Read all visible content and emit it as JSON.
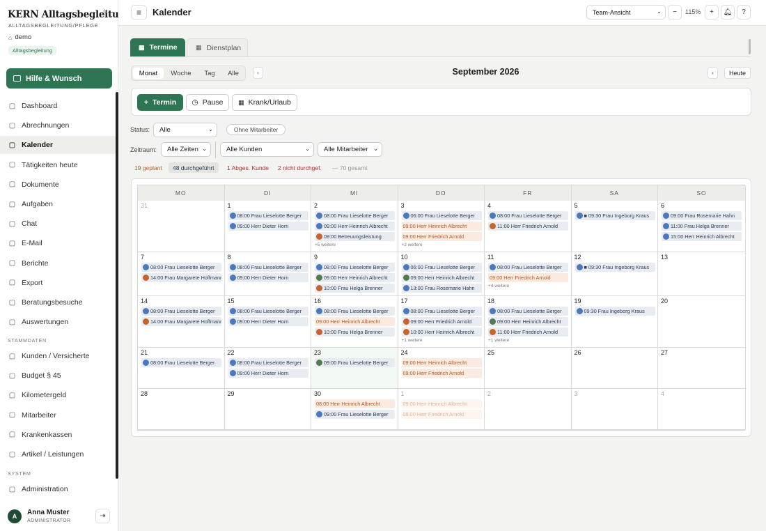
{
  "sidebar": {
    "brand": "KERN Alltagsbegleitung",
    "subtitle": "ALLTAGSBEGLEITUNG/PFLEGE",
    "tenant": "demo",
    "tenant_badge": "Alltagsbegleitung",
    "help_label": "Hilfe & Wunsch",
    "nav": [
      {
        "label": "Dashboard",
        "icon": "grid-icon"
      },
      {
        "label": "Abrechnungen",
        "icon": "file-icon"
      },
      {
        "label": "Kalender",
        "icon": "calendar-icon",
        "active": true
      },
      {
        "label": "Tätigkeiten heute",
        "icon": "clock-icon"
      },
      {
        "label": "Dokumente",
        "icon": "folder-icon"
      },
      {
        "label": "Aufgaben",
        "icon": "check-icon"
      },
      {
        "label": "Chat",
        "icon": "chat-icon"
      },
      {
        "label": "E-Mail",
        "icon": "mail-icon"
      },
      {
        "label": "Berichte",
        "icon": "chart-icon"
      },
      {
        "label": "Export",
        "icon": "download-icon"
      },
      {
        "label": "Beratungsbesuche",
        "icon": "clipboard-icon"
      },
      {
        "label": "Auswertungen",
        "icon": "pie-icon"
      }
    ],
    "section_stammdaten": "STAMMDATEN",
    "stammdaten": [
      {
        "label": "Kunden / Versicherte",
        "icon": "user-icon"
      },
      {
        "label": "Budget § 45",
        "icon": "budget-icon"
      },
      {
        "label": "Kilometergeld",
        "icon": "car-icon"
      },
      {
        "label": "Mitarbeiter",
        "icon": "users-icon"
      },
      {
        "label": "Krankenkassen",
        "icon": "building-icon"
      },
      {
        "label": "Artikel / Leistungen",
        "icon": "box-icon"
      }
    ],
    "section_system": "SYSTEM",
    "system": [
      {
        "label": "Administration",
        "icon": "shield-icon"
      }
    ],
    "user": {
      "initial": "A",
      "name": "Anna Muster",
      "role": "ADMINISTRATOR"
    }
  },
  "header": {
    "title": "Kalender",
    "view_select": "Team-Ansicht",
    "zoom": "115%"
  },
  "tabs": {
    "termine": "Termine",
    "dienstplan": "Dienstplan"
  },
  "views": [
    "Monat",
    "Woche",
    "Tag",
    "Alle"
  ],
  "month_title": "September 2026",
  "today_label": "Heute",
  "actions": {
    "termin": "Termin",
    "pause": "Pause",
    "krank": "Krank/Urlaub"
  },
  "filters": {
    "status_label": "Status:",
    "status_value": "Alle",
    "ohne_mitarbeiter": "Ohne Mitarbeiter",
    "zeitraum_label": "Zeitraum:",
    "zeitraum_value": "Alle Zeiten",
    "kunden_value": "Alle Kunden",
    "mitarbeiter_value": "Alle Mitarbeiter"
  },
  "stats": {
    "geplant": "19 geplant",
    "durchgefuehrt": "48 durchgeführt",
    "abgesagt": "1 Abges. Kunde",
    "nicht": "2 nicht durchgef.",
    "gesamt": "— 70 gesamt"
  },
  "colors": {
    "accent": "#2e7653",
    "planned": "#b65a26",
    "done": "#2c3e55"
  },
  "weekdays": [
    "MO",
    "DI",
    "MI",
    "DO",
    "FR",
    "SA",
    "SO"
  ],
  "weeks": [
    [
      {
        "day": "31",
        "muted": true,
        "events": []
      },
      {
        "day": "1",
        "events": [
          {
            "t": "08:00 Frau Lieselotte Berger",
            "s": "blue",
            "d": "blue"
          },
          {
            "t": "09:00 Herr Dieter Horn",
            "s": "blue",
            "d": "blue"
          }
        ]
      },
      {
        "day": "2",
        "events": [
          {
            "t": "08:00 Frau Lieselotte Berger",
            "s": "blue",
            "d": "blue"
          },
          {
            "t": "09:00 Herr Heinrich Albrecht",
            "s": "blue",
            "d": "blue"
          },
          {
            "t": "09:00 Betreuungsleistung",
            "s": "blue",
            "d": "orange"
          }
        ],
        "more": "+5 weitere"
      },
      {
        "day": "3",
        "events": [
          {
            "t": "06:00 Frau Lieselotte Berger",
            "s": "blue",
            "d": "blue"
          },
          {
            "t": "09:00 Herr Heinrich Albrecht",
            "s": "peach"
          },
          {
            "t": "09:00 Herr Friedrich Arnold",
            "s": "peach"
          }
        ],
        "more": "+2 weitere"
      },
      {
        "day": "4",
        "events": [
          {
            "t": "08:00 Frau Lieselotte Berger",
            "s": "blue",
            "d": "blue"
          },
          {
            "t": "11:00 Herr Friedrich Arnold",
            "s": "blue",
            "d": "orange"
          }
        ]
      },
      {
        "day": "5",
        "events": [
          {
            "t": "■ 09:30 Frau Ingeborg Kraus",
            "s": "blue",
            "d": "blue"
          }
        ]
      },
      {
        "day": "6",
        "events": [
          {
            "t": "09:00 Frau Rosemarie Hahn",
            "s": "blue",
            "d": "blue"
          },
          {
            "t": "11:00 Frau Helga Brenner",
            "s": "blue",
            "d": "blue"
          },
          {
            "t": "15:00 Herr Heinrich Albrecht",
            "s": "blue",
            "d": "blue"
          }
        ]
      }
    ],
    [
      {
        "day": "7",
        "events": [
          {
            "t": "08:00 Frau Lieselotte Berger",
            "s": "blue",
            "d": "blue"
          },
          {
            "t": "14:00 Frau Margarete Hoffmann",
            "s": "blue",
            "d": "orange"
          }
        ]
      },
      {
        "day": "8",
        "events": [
          {
            "t": "08:00 Frau Lieselotte Berger",
            "s": "blue",
            "d": "blue"
          },
          {
            "t": "09:00 Herr Dieter Horn",
            "s": "blue",
            "d": "blue"
          }
        ]
      },
      {
        "day": "9",
        "events": [
          {
            "t": "08:00 Frau Lieselotte Berger",
            "s": "blue",
            "d": "blue"
          },
          {
            "t": "09:00 Herr Heinrich Albrecht",
            "s": "blue",
            "d": "green"
          },
          {
            "t": "10:00 Frau Helga Brenner",
            "s": "blue",
            "d": "orange"
          }
        ]
      },
      {
        "day": "10",
        "events": [
          {
            "t": "06:00 Frau Lieselotte Berger",
            "s": "blue",
            "d": "blue"
          },
          {
            "t": "09:00 Herr Heinrich Albrecht",
            "s": "blue",
            "d": "green"
          },
          {
            "t": "13:00 Frau Rosemarie Hahn",
            "s": "blue",
            "d": "blue"
          }
        ]
      },
      {
        "day": "11",
        "events": [
          {
            "t": "08:00 Frau Lieselotte Berger",
            "s": "blue",
            "d": "blue"
          },
          {
            "t": "09:00 Herr Friedrich Arnold",
            "s": "peach"
          }
        ],
        "more": "+4 weitere"
      },
      {
        "day": "12",
        "events": [
          {
            "t": "■ 09:30 Frau Ingeborg Kraus",
            "s": "blue",
            "d": "blue"
          }
        ]
      },
      {
        "day": "13",
        "events": []
      }
    ],
    [
      {
        "day": "14",
        "events": [
          {
            "t": "08:00 Frau Lieselotte Berger",
            "s": "blue",
            "d": "blue"
          },
          {
            "t": "14:00 Frau Margarete Hoffmann",
            "s": "blue",
            "d": "orange"
          }
        ]
      },
      {
        "day": "15",
        "events": [
          {
            "t": "08:00 Frau Lieselotte Berger",
            "s": "blue",
            "d": "blue"
          },
          {
            "t": "09:00 Herr Dieter Horn",
            "s": "blue",
            "d": "blue"
          }
        ]
      },
      {
        "day": "16",
        "events": [
          {
            "t": "08:00 Frau Lieselotte Berger",
            "s": "blue",
            "d": "blue"
          },
          {
            "t": "09:00 Herr Heinrich Albrecht",
            "s": "peach"
          },
          {
            "t": "10:00 Frau Helga Brenner",
            "s": "blue",
            "d": "orange"
          }
        ]
      },
      {
        "day": "17",
        "events": [
          {
            "t": "08:00 Frau Lieselotte Berger",
            "s": "blue",
            "d": "blue"
          },
          {
            "t": "09:00 Herr Friedrich Arnold",
            "s": "blue",
            "d": "orange"
          },
          {
            "t": "10:00 Herr Heinrich Albrecht",
            "s": "blue",
            "d": "orange"
          }
        ],
        "more": "+1 weitere"
      },
      {
        "day": "18",
        "events": [
          {
            "t": "08:00 Frau Lieselotte Berger",
            "s": "blue",
            "d": "blue"
          },
          {
            "t": "09:00 Herr Heinrich Albrecht",
            "s": "blue",
            "d": "green"
          },
          {
            "t": "11:00 Herr Friedrich Arnold",
            "s": "blue",
            "d": "orange"
          }
        ],
        "more": "+1 weitere"
      },
      {
        "day": "19",
        "events": [
          {
            "t": "09:30 Frau Ingeborg Kraus",
            "s": "blue",
            "d": "blue"
          }
        ]
      },
      {
        "day": "20",
        "events": []
      }
    ],
    [
      {
        "day": "21",
        "events": [
          {
            "t": "08:00 Frau Lieselotte Berger",
            "s": "blue",
            "d": "blue"
          }
        ]
      },
      {
        "day": "22",
        "events": [
          {
            "t": "08:00 Frau Lieselotte Berger",
            "s": "blue",
            "d": "blue"
          },
          {
            "t": "09:00 Herr Dieter Horn",
            "s": "blue",
            "d": "blue"
          }
        ]
      },
      {
        "day": "23",
        "today": true,
        "events": [
          {
            "t": "09:00 Frau Lieselotte Berger",
            "s": "blue",
            "d": "green"
          }
        ]
      },
      {
        "day": "24",
        "events": [
          {
            "t": "09:00 Herr Heinrich Albrecht",
            "s": "peach"
          },
          {
            "t": "09:00 Herr Friedrich Arnold",
            "s": "peach"
          }
        ]
      },
      {
        "day": "25",
        "events": []
      },
      {
        "day": "26",
        "events": []
      },
      {
        "day": "27",
        "events": []
      }
    ],
    [
      {
        "day": "28",
        "events": []
      },
      {
        "day": "29",
        "events": []
      },
      {
        "day": "30",
        "events": [
          {
            "t": "08:00 Herr Heinrich Albrecht",
            "s": "peach"
          },
          {
            "t": "09:00 Frau Lieselotte Berger",
            "s": "blue",
            "d": "blue"
          }
        ]
      },
      {
        "day": "1",
        "muted": true,
        "events": [
          {
            "t": "09:00 Herr Heinrich Albrecht",
            "s": "peach",
            "m": true
          },
          {
            "t": "09:00 Herr Friedrich Arnold",
            "s": "peach",
            "m": true
          }
        ]
      },
      {
        "day": "2",
        "muted": true,
        "events": []
      },
      {
        "day": "3",
        "muted": true,
        "events": []
      },
      {
        "day": "4",
        "muted": true,
        "events": []
      }
    ]
  ]
}
